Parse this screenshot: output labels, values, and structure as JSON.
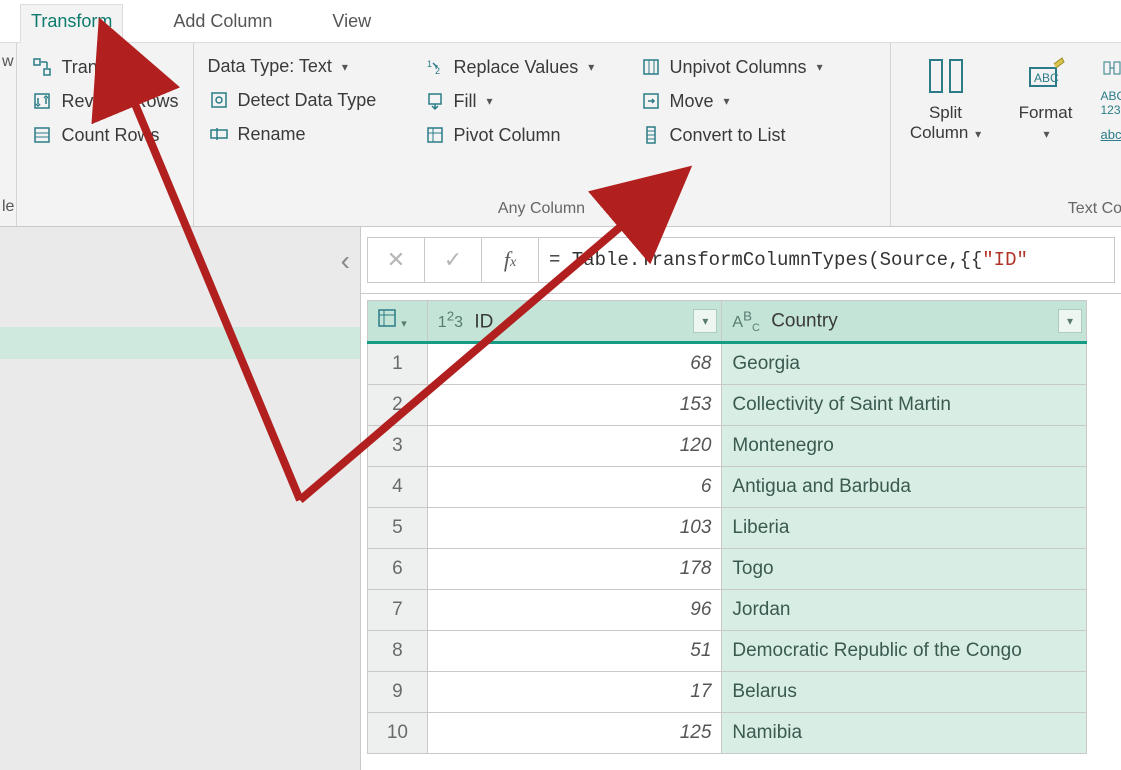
{
  "tabs": {
    "transform": "Transform",
    "addcol": "Add Column",
    "view": "View"
  },
  "ribbon": {
    "left_frag_top": "w",
    "left_frag_bottom": "le",
    "table": {
      "transpose": "Transpose",
      "reverse": "Reverse Rows",
      "count": "Count Rows"
    },
    "anycol": {
      "datatype": "Data Type: Text",
      "detect": "Detect Data Type",
      "rename": "Rename",
      "replace": "Replace Values",
      "fill": "Fill",
      "pivot": "Pivot Column",
      "unpivot": "Unpivot Columns",
      "move": "Move",
      "convert": "Convert to List",
      "caption": "Any Column"
    },
    "textcol": {
      "split_top": "Split",
      "split_bottom": "Column",
      "format": "Format",
      "caption": "Text Colu",
      "frag1": "123",
      "frag2": "abc"
    }
  },
  "formula": {
    "prefix": "= Table.TransformColumnTypes(Source,{{",
    "str": "\"ID\""
  },
  "grid": {
    "columns": {
      "id": "ID",
      "country": "Country"
    },
    "rows": [
      {
        "n": "1",
        "id": "68",
        "country": "Georgia"
      },
      {
        "n": "2",
        "id": "153",
        "country": "Collectivity of Saint Martin"
      },
      {
        "n": "3",
        "id": "120",
        "country": "Montenegro"
      },
      {
        "n": "4",
        "id": "6",
        "country": "Antigua and Barbuda"
      },
      {
        "n": "5",
        "id": "103",
        "country": "Liberia"
      },
      {
        "n": "6",
        "id": "178",
        "country": "Togo"
      },
      {
        "n": "7",
        "id": "96",
        "country": "Jordan"
      },
      {
        "n": "8",
        "id": "51",
        "country": "Democratic Republic of the Congo"
      },
      {
        "n": "9",
        "id": "17",
        "country": "Belarus"
      },
      {
        "n": "10",
        "id": "125",
        "country": "Namibia"
      }
    ]
  }
}
